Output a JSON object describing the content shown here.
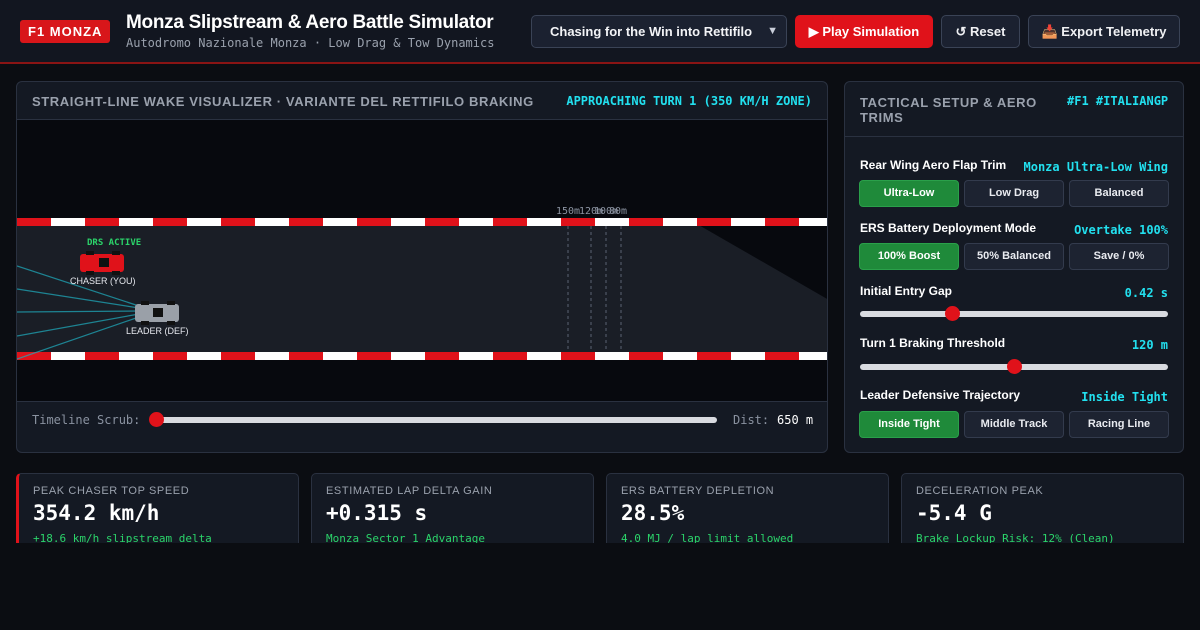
{
  "header": {
    "badge": "F1 MONZA",
    "title": "Monza Slipstream & Aero Battle Simulator",
    "subtitle": "Autodromo Nazionale Monza · Low Drag & Tow Dynamics",
    "scenario_selected": "Chasing for the Win into Rettifilo",
    "play_label": "▶ Play Simulation",
    "reset_label": "↺ Reset",
    "export_label": "📥 Export Telemetry"
  },
  "visualizer": {
    "title": "Straight-Line Wake Visualizer · Variante del Rettifilo Braking",
    "status": "APPROACHING TURN 1 (350 KM/H ZONE)",
    "drs_label": "DRS ACTIVE",
    "chaser_label": "CHASER (YOU)",
    "leader_label": "LEADER (DEF)",
    "braking_markers": [
      "150m",
      "120m",
      "100m",
      "80m"
    ],
    "colors": {
      "chaser": "#e0121a",
      "leader": "#9aa0a8",
      "wake": "#1fa7b8",
      "drs": "#2bd46a",
      "kerb_red": "#e0121a",
      "kerb_white": "#ffffff"
    }
  },
  "timeline": {
    "label": "Timeline Scrub:",
    "position_fraction": 0.0,
    "dist_label": "Dist:",
    "dist_value": "650 m"
  },
  "setup": {
    "title": "Tactical Setup & Aero Trims",
    "tag": "#F1 #ITALIANGP",
    "rear_wing": {
      "label": "Rear Wing Aero Flap Trim",
      "value": "Monza Ultra-Low Wing",
      "options": [
        "Ultra-Low",
        "Low Drag",
        "Balanced"
      ],
      "active_index": 0
    },
    "ers": {
      "label": "ERS Battery Deployment Mode",
      "value": "Overtake 100%",
      "options": [
        "100% Boost",
        "50% Balanced",
        "Save / 0%"
      ],
      "active_index": 0
    },
    "entry_gap": {
      "label": "Initial Entry Gap",
      "value": "0.42 s",
      "fraction": 0.3
    },
    "braking_threshold": {
      "label": "Turn 1 Braking Threshold",
      "value": "120 m",
      "fraction": 0.5
    },
    "trajectory": {
      "label": "Leader Defensive Trajectory",
      "value": "Inside Tight",
      "options": [
        "Inside Tight",
        "Middle Track",
        "Racing Line"
      ],
      "active_index": 0
    }
  },
  "metrics": [
    {
      "label": "Peak Chaser Top Speed",
      "value": "354.2 km/h",
      "sub": "+18.6 km/h slipstream delta"
    },
    {
      "label": "Estimated Lap Delta Gain",
      "value": "+0.315 s",
      "sub": "Monza Sector 1 Advantage"
    },
    {
      "label": "ERS Battery Depletion",
      "value": "28.5%",
      "sub": "4.0 MJ / lap limit allowed"
    },
    {
      "label": "Deceleration Peak",
      "value": "-5.4 G",
      "sub": "Brake Lockup Risk: 12% (Clean)"
    }
  ]
}
